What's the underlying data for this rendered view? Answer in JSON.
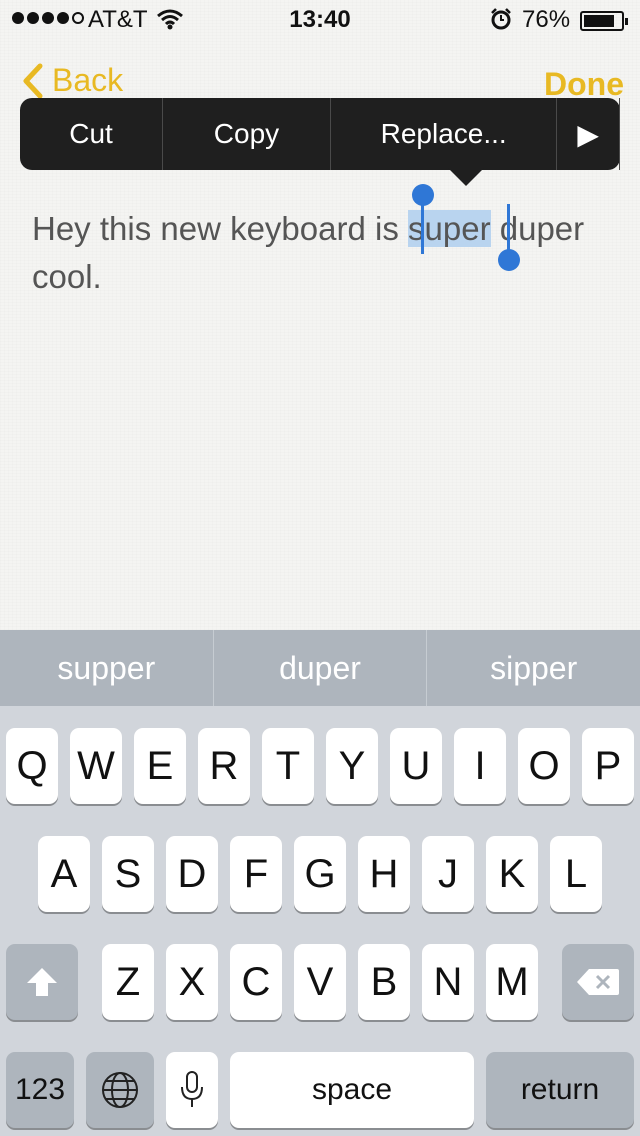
{
  "status": {
    "carrier": "AT&T",
    "time": "13:40",
    "battery": "76%"
  },
  "nav": {
    "back": "Back",
    "done": "Done"
  },
  "menu": {
    "items": [
      "Cut",
      "Copy",
      "Replace...",
      "▶"
    ]
  },
  "note": {
    "before": "Hey this new keyboard is ",
    "selected": "super",
    "after": " duper cool."
  },
  "suggestions": [
    "supper",
    "duper",
    "sipper"
  ],
  "keyboard": {
    "row1": [
      "Q",
      "W",
      "E",
      "R",
      "T",
      "Y",
      "U",
      "I",
      "O",
      "P"
    ],
    "row2": [
      "A",
      "S",
      "D",
      "F",
      "G",
      "H",
      "J",
      "K",
      "L"
    ],
    "row3": [
      "Z",
      "X",
      "C",
      "V",
      "B",
      "N",
      "M"
    ],
    "numbers": "123",
    "space": "space",
    "return": "return"
  },
  "colors": {
    "accent": "#e8b923",
    "selection": "#2f77d6"
  }
}
